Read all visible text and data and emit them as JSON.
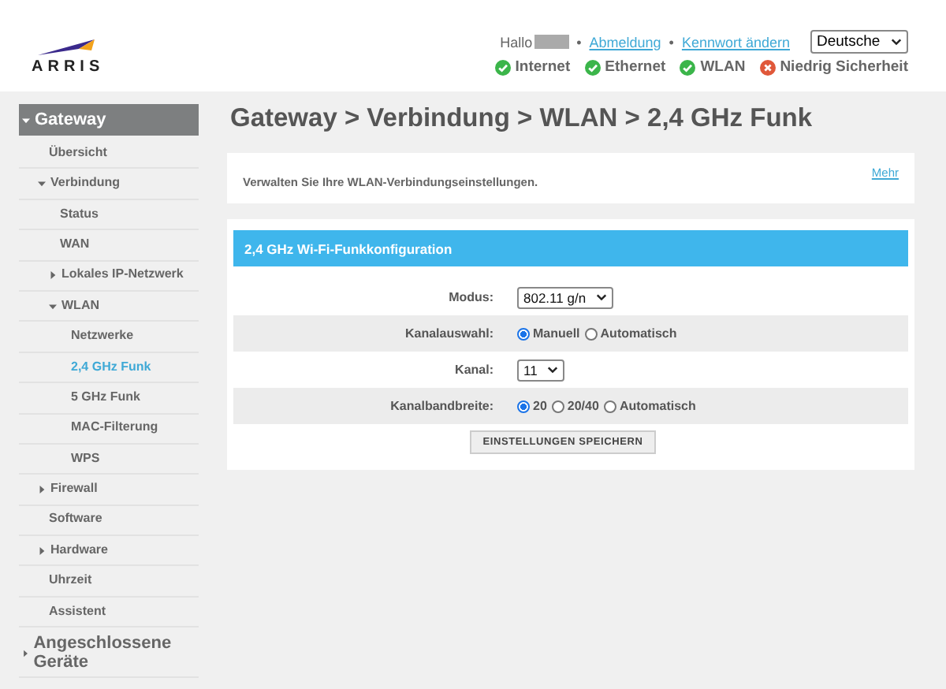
{
  "header": {
    "logo": "ARRIS",
    "greeting": "Hallo",
    "links": [
      {
        "separator": "•",
        "label": "Abmeldung"
      },
      {
        "separator": "•",
        "label": "Kennwort ändern"
      }
    ],
    "language": "Deutsche",
    "status": [
      {
        "label": "Internet",
        "kind": "ok"
      },
      {
        "label": "Ethernet",
        "kind": "ok"
      },
      {
        "label": "WLAN",
        "kind": "ok"
      },
      {
        "label": "Niedrig Sicherheit",
        "kind": "error"
      }
    ]
  },
  "sidebar": {
    "items": [
      {
        "label": "Gateway",
        "expanded": true,
        "selected": false,
        "children": [
          {
            "label": "Übersicht",
            "selected": false
          },
          {
            "label": "Verbindung",
            "expanded": true,
            "selected": false,
            "children": [
              {
                "label": "Status",
                "selected": false
              },
              {
                "label": "WAN",
                "selected": false
              },
              {
                "label": "Lokales IP-Netzwerk",
                "expanded": false,
                "selected": false
              },
              {
                "label": "WLAN",
                "expanded": true,
                "selected": false,
                "children": [
                  {
                    "label": "Netzwerke",
                    "selected": false
                  },
                  {
                    "label": "2,4 GHz Funk",
                    "selected": true
                  },
                  {
                    "label": "5 GHz Funk",
                    "selected": false
                  },
                  {
                    "label": "MAC-Filterung",
                    "selected": false
                  },
                  {
                    "label": "WPS",
                    "selected": false
                  }
                ]
              }
            ]
          },
          {
            "label": "Firewall",
            "expanded": false,
            "selected": false
          },
          {
            "label": "Software",
            "selected": false
          },
          {
            "label": "Hardware",
            "expanded": false,
            "selected": false
          },
          {
            "label": "Uhrzeit",
            "selected": false
          },
          {
            "label": "Assistent",
            "selected": false
          }
        ]
      },
      {
        "label": "Angeschlossene Geräte",
        "expanded": false,
        "selected": false
      }
    ]
  },
  "breadcrumb": "Gateway > Verbindung > WLAN > 2,4 GHz Funk",
  "info": {
    "text": "Verwalten Sie Ihre WLAN-Verbindungseinstellungen.",
    "link": "Mehr"
  },
  "config": {
    "title": "2,4 GHz Wi-Fi-Funkkonfiguration",
    "rows": [
      {
        "label": "Modus:",
        "kind": "select",
        "value": "802.11 g/n"
      },
      {
        "label": "Kanalauswahl:",
        "kind": "radio",
        "options": [
          {
            "label": "Manuell",
            "selected": true
          },
          {
            "label": "Automatisch",
            "selected": false
          }
        ]
      },
      {
        "label": "Kanal:",
        "kind": "select",
        "value": "11"
      },
      {
        "label": "Kanalbandbreite:",
        "kind": "radio",
        "options": [
          {
            "label": "20",
            "selected": true
          },
          {
            "label": "20/40",
            "selected": false
          },
          {
            "label": "Automatisch",
            "selected": false
          }
        ]
      }
    ],
    "save_button": "EINSTELLUNGEN SPEICHERN"
  }
}
